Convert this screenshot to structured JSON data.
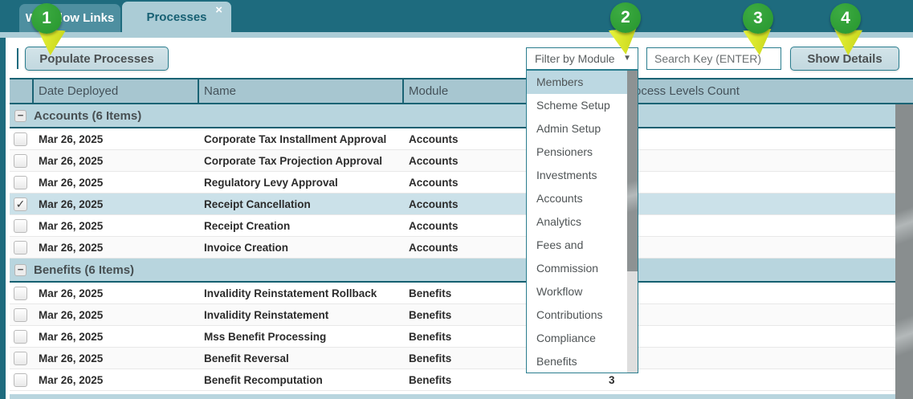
{
  "window": {
    "tabs": [
      {
        "label": "Workflow Links",
        "active": false
      },
      {
        "label": "Processes",
        "active": true,
        "close_glyph": "×"
      }
    ]
  },
  "toolbar": {
    "populate_button": "Populate Processes",
    "filter_dropdown": {
      "value": "Filter by Module",
      "caret_glyph": "▼"
    },
    "search_input": {
      "placeholder": "Search Key (ENTER)",
      "value": ""
    },
    "show_details_button": "Show Details"
  },
  "annotations": {
    "badges": [
      "1",
      "2",
      "3",
      "4"
    ]
  },
  "module_dropdown": {
    "selected": "Members",
    "options": [
      "Members",
      "Scheme Setup",
      "Admin Setup",
      "Pensioners",
      "Investments",
      "Accounts",
      "Analytics",
      "Fees and Commission",
      "Workflow",
      "Contributions",
      "Compliance",
      "Benefits"
    ]
  },
  "table": {
    "columns": {
      "date": "Date Deployed",
      "name": "Name",
      "module": "Module",
      "levels_count": "Process Levels Count"
    },
    "groups": [
      {
        "label": "Accounts (6 Items)",
        "collapse_glyph": "−",
        "rows": [
          {
            "checked": false,
            "selected": false,
            "date": "Mar 26, 2025",
            "name": "Corporate Tax Installment Approval",
            "module": "Accounts",
            "levels_count": ""
          },
          {
            "checked": false,
            "selected": false,
            "date": "Mar 26, 2025",
            "name": "Corporate Tax Projection Approval",
            "module": "Accounts",
            "levels_count": ""
          },
          {
            "checked": false,
            "selected": false,
            "date": "Mar 26, 2025",
            "name": "Regulatory Levy Approval",
            "module": "Accounts",
            "levels_count": ""
          },
          {
            "checked": true,
            "selected": true,
            "date": "Mar 26, 2025",
            "name": "Receipt Cancellation",
            "module": "Accounts",
            "levels_count": ""
          },
          {
            "checked": false,
            "selected": false,
            "date": "Mar 26, 2025",
            "name": "Receipt Creation",
            "module": "Accounts",
            "levels_count": ""
          },
          {
            "checked": false,
            "selected": false,
            "date": "Mar 26, 2025",
            "name": "Invoice Creation",
            "module": "Accounts",
            "levels_count": ""
          }
        ]
      },
      {
        "label": "Benefits (6 Items)",
        "collapse_glyph": "−",
        "rows": [
          {
            "checked": false,
            "selected": false,
            "date": "Mar 26, 2025",
            "name": "Invalidity Reinstatement Rollback",
            "module": "Benefits",
            "levels_count": ""
          },
          {
            "checked": false,
            "selected": false,
            "date": "Mar 26, 2025",
            "name": "Invalidity Reinstatement",
            "module": "Benefits",
            "levels_count": ""
          },
          {
            "checked": false,
            "selected": false,
            "date": "Mar 26, 2025",
            "name": "Mss Benefit Processing",
            "module": "Benefits",
            "levels_count": ""
          },
          {
            "checked": false,
            "selected": false,
            "date": "Mar 26, 2025",
            "name": "Benefit Reversal",
            "module": "Benefits",
            "levels_count": ""
          },
          {
            "checked": false,
            "selected": false,
            "date": "Mar 26, 2025",
            "name": "Benefit Recomputation",
            "module": "Benefits",
            "levels_count": "3"
          }
        ]
      }
    ]
  },
  "colors": {
    "teal_dark": "#1e6b7e",
    "tab_inactive": "#4e8fa0",
    "tab_active": "#abccd6",
    "control_border": "#2a7d8e",
    "button_bg": "#c7dce2",
    "table_header_bg": "#a7c6d0",
    "group_row_bg": "#b8d5de",
    "selected_row_bg": "#cbe1e9",
    "dropdown_highlight": "#bcd8e2",
    "scroll_gray": "#8d9293",
    "badge_green": "#2f9e36",
    "pointer_yellow": "#d9e626"
  }
}
